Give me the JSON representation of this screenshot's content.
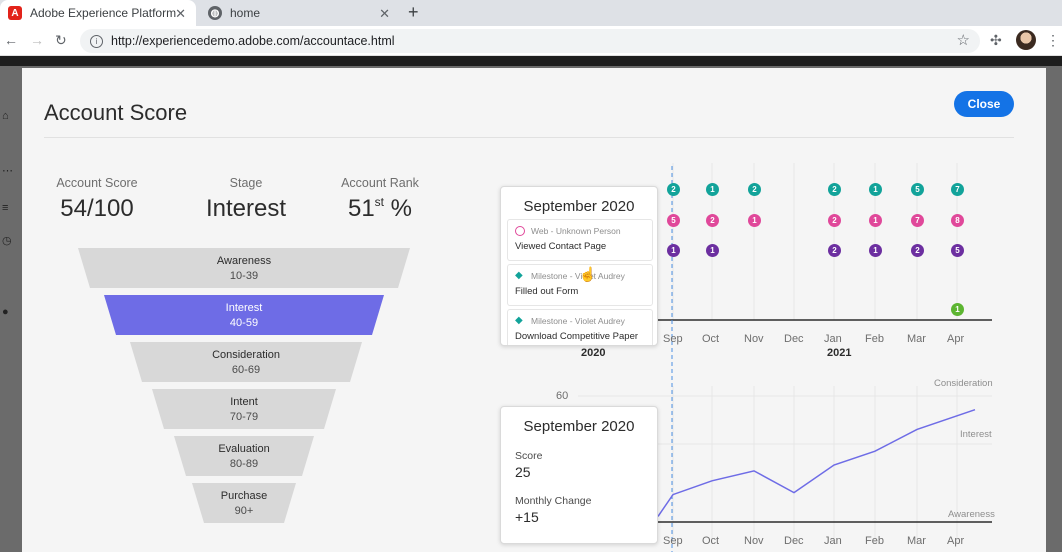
{
  "browser": {
    "tabs": [
      {
        "title": "Adobe Experience Platform",
        "active": true
      },
      {
        "title": "home",
        "active": false
      }
    ],
    "url": "http://experiencedemo.adobe.com/accountace.html"
  },
  "modal": {
    "title": "Account Score",
    "close_label": "Close",
    "metrics": [
      {
        "label": "Account Score",
        "value": "54/100"
      },
      {
        "label": "Stage",
        "value": "Interest"
      },
      {
        "label": "Account Rank",
        "value": "51",
        "sup": "st",
        "suffix": " %"
      }
    ],
    "funnel": [
      {
        "name": "Awareness",
        "range": "10-39",
        "active": false
      },
      {
        "name": "Interest",
        "range": "40-59",
        "active": true
      },
      {
        "name": "Consideration",
        "range": "60-69",
        "active": false
      },
      {
        "name": "Intent",
        "range": "70-79",
        "active": false
      },
      {
        "name": "Evaluation",
        "range": "80-89",
        "active": false
      },
      {
        "name": "Purchase",
        "range": "90+",
        "active": false
      }
    ]
  },
  "activity_chart": {
    "months": [
      "Sep",
      "Oct",
      "Nov",
      "Dec",
      "Jan",
      "Feb",
      "Mar",
      "Apr"
    ],
    "year_labels": {
      "left": "2020",
      "right": "2021"
    },
    "colors": {
      "teal": "#12a39a",
      "pink": "#e0489a",
      "purple": "#6c2fa0",
      "green": "#5cb531"
    },
    "rows": [
      {
        "color": "teal",
        "counts": [
          "2",
          "1",
          "2",
          "",
          "2",
          "1",
          "5",
          "7"
        ]
      },
      {
        "color": "pink",
        "counts": [
          "5",
          "2",
          "1",
          "",
          "2",
          "1",
          "7",
          "8"
        ]
      },
      {
        "color": "purple",
        "counts": [
          "1",
          "1",
          "",
          "",
          "2",
          "1",
          "2",
          "5"
        ]
      },
      {
        "color": "green",
        "counts": [
          "",
          "",
          "",
          "",
          "",
          "",
          "",
          "1"
        ]
      }
    ]
  },
  "activity_tooltip": {
    "title": "September 2020",
    "cards": [
      {
        "type": "web",
        "source": "Web - Unknown Person",
        "action": "Viewed Contact Page"
      },
      {
        "type": "milestone",
        "source": "Milestone - Violet Audrey",
        "action": "Filled out Form"
      },
      {
        "type": "milestone",
        "source": "Milestone - Violet Audrey",
        "action": "Download Competitive Paper"
      }
    ]
  },
  "score_chart": {
    "type": "line",
    "y_label_tick": "60",
    "band_labels": [
      "Consideration",
      "Interest",
      "Awareness"
    ],
    "months": [
      "Sep",
      "Oct",
      "Nov",
      "Dec",
      "Jan",
      "Feb",
      "Mar",
      "Apr"
    ],
    "year_labels": {
      "left": "2020",
      "right": "2021"
    },
    "series": [
      {
        "values": [
          25,
          32,
          37,
          26,
          40,
          47,
          58,
          68
        ]
      }
    ],
    "line_color": "#6e6ce6"
  },
  "score_tooltip": {
    "title": "September 2020",
    "score_label": "Score",
    "score_value": "25",
    "change_label": "Monthly Change",
    "change_value": "+15"
  }
}
